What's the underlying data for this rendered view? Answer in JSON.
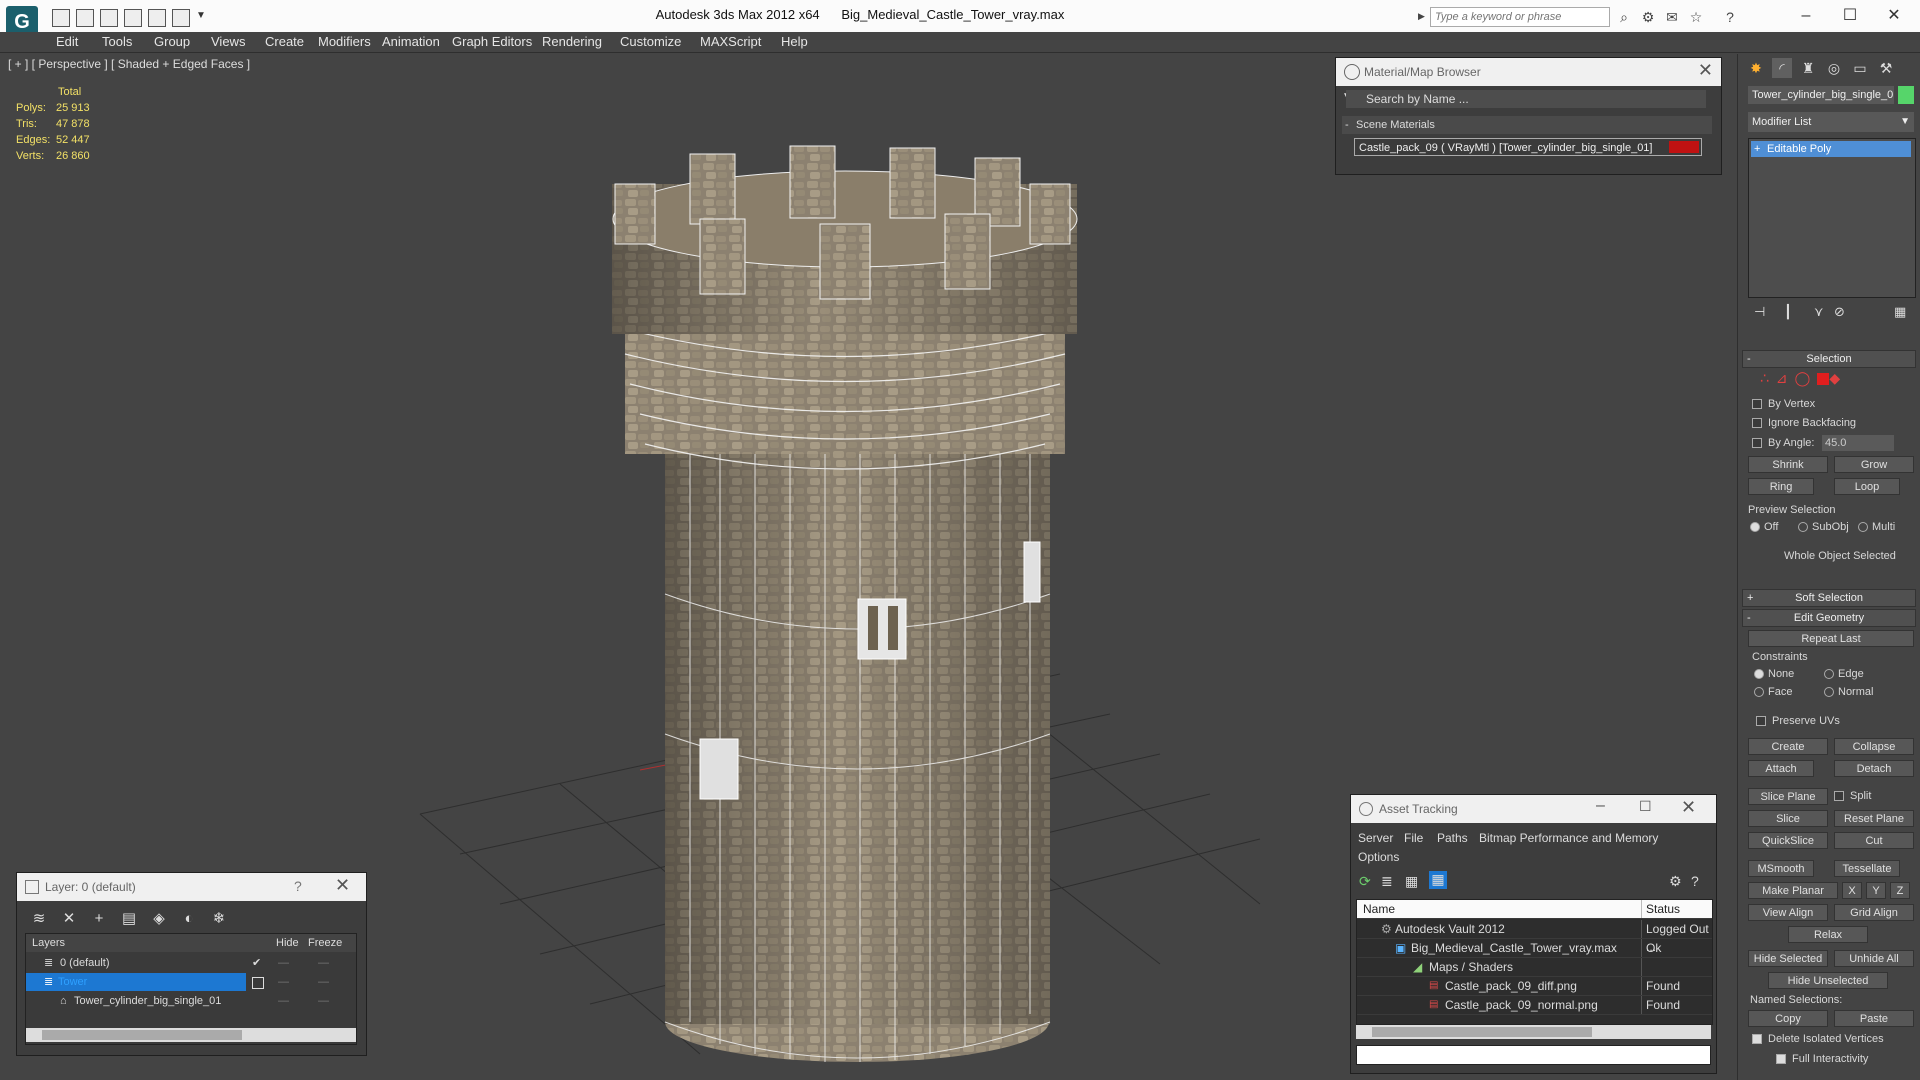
{
  "app": {
    "title": "Autodesk 3ds Max  2012 x64",
    "file": "Big_Medieval_Castle_Tower_vray.max",
    "search_placeholder": "Type a keyword or phrase",
    "logo_glyph": "G"
  },
  "menu": [
    "Edit",
    "Tools",
    "Group",
    "Views",
    "Create",
    "Modifiers",
    "Animation",
    "Graph Editors",
    "Rendering",
    "Customize",
    "MAXScript",
    "Help"
  ],
  "viewport": {
    "label": "[ + ] [ Perspective ] [ Shaded + Edged Faces ]",
    "stats": {
      "header": "Total",
      "polys_label": "Polys:",
      "polys": "25 913",
      "tris_label": "Tris:",
      "tris": "47 878",
      "edges_label": "Edges:",
      "edges": "52 447",
      "verts_label": "Verts:",
      "verts": "26 860"
    }
  },
  "material_browser": {
    "title": "Material/Map Browser",
    "search": "Search by Name ...",
    "section": "Scene Materials",
    "item": "Castle_pack_09  ( VRayMtl )  [Tower_cylinder_big_single_01]",
    "swatch_color": "#c01212"
  },
  "layer_panel": {
    "title": "Layer: 0 (default)",
    "col_layers": "Layers",
    "col_hide": "Hide",
    "col_freeze": "Freeze",
    "rows": [
      "0 (default)",
      "Tower",
      "Tower_cylinder_big_single_01"
    ]
  },
  "asset_tracking": {
    "title": "Asset Tracking",
    "menu": [
      "Server",
      "File",
      "Paths",
      "Bitmap Performance and Memory",
      "Options"
    ],
    "col_name": "Name",
    "col_status": "Status",
    "rows": [
      {
        "name": "Autodesk Vault 2012",
        "status": "Logged Out ..."
      },
      {
        "name": "Big_Medieval_Castle_Tower_vray.max",
        "status": "Ok"
      },
      {
        "name": "Maps / Shaders",
        "status": ""
      },
      {
        "name": "Castle_pack_09_diff.png",
        "status": "Found"
      },
      {
        "name": "Castle_pack_09_normal.png",
        "status": "Found"
      }
    ]
  },
  "command_panel": {
    "object_name": "Tower_cylinder_big_single_0",
    "object_color": "#56d56a",
    "modifier_list": "Modifier List",
    "stack_item": "Editable Poly",
    "selection": {
      "title": "Selection",
      "by_vertex": "By Vertex",
      "ignore_backfacing": "Ignore Backfacing",
      "by_angle": "By Angle:",
      "angle_value": "45.0",
      "shrink": "Shrink",
      "grow": "Grow",
      "ring": "Ring",
      "loop": "Loop",
      "preview_selection": "Preview Selection",
      "off": "Off",
      "subobj": "SubObj",
      "multi": "Multi",
      "whole_object": "Whole Object Selected"
    },
    "soft_selection": "Soft Selection",
    "edit_geometry": {
      "title": "Edit Geometry",
      "repeat_last": "Repeat Last",
      "constraints": "Constraints",
      "none": "None",
      "edge": "Edge",
      "face": "Face",
      "normal": "Normal",
      "preserve_uvs": "Preserve UVs",
      "create": "Create",
      "collapse": "Collapse",
      "attach": "Attach",
      "detach": "Detach",
      "slice_plane": "Slice Plane",
      "split": "Split",
      "slice": "Slice",
      "reset_plane": "Reset Plane",
      "quickslice": "QuickSlice",
      "cut": "Cut",
      "msmooth": "MSmooth",
      "tessellate": "Tessellate",
      "make_planar": "Make Planar",
      "x": "X",
      "y": "Y",
      "z": "Z",
      "view_align": "View Align",
      "grid_align": "Grid Align",
      "relax": "Relax",
      "hide_selected": "Hide Selected",
      "unhide_all": "Unhide All",
      "hide_unselected": "Hide Unselected",
      "named_selections": "Named Selections:",
      "copy": "Copy",
      "paste": "Paste",
      "delete_isolated": "Delete Isolated Vertices",
      "full_interactivity": "Full Interactivity"
    }
  }
}
